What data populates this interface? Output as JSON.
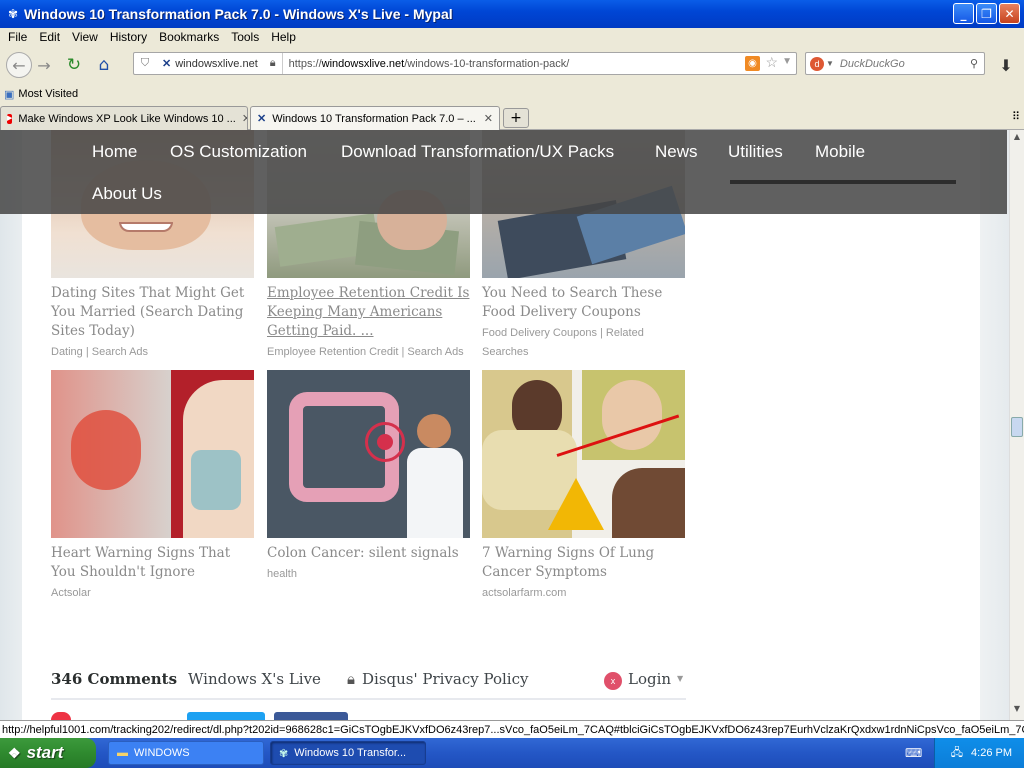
{
  "window": {
    "title": "Windows 10 Transformation Pack 7.0 - Windows X's Live - Mypal"
  },
  "menu": [
    "File",
    "Edit",
    "View",
    "History",
    "Bookmarks",
    "Tools",
    "Help"
  ],
  "address": {
    "site": "windowsxlive.net",
    "url_prefix": "https://",
    "url_host": "windowsxlive.net",
    "url_path": "/windows-10-transformation-pack/"
  },
  "search": {
    "placeholder": "DuckDuckGo"
  },
  "bookmarks": {
    "most_visited": "Most Visited"
  },
  "tabs": [
    {
      "label": "Make Windows XP Look Like Windows 10 ..."
    },
    {
      "label": "Windows 10 Transformation Pack 7.0 – ..."
    }
  ],
  "site_nav": [
    "Home",
    "OS Customization",
    "Download Transformation/UX Packs",
    "News",
    "Utilities",
    "Mobile",
    "About Us"
  ],
  "cards": [
    {
      "title": "Dating Sites That Might Get You Married (Search Dating Sites Today)",
      "source": "Dating | Search Ads"
    },
    {
      "title": "Employee Retention Credit Is Keeping Many Americans Getting Paid. ...",
      "source": "Employee Retention Credit | Search Ads"
    },
    {
      "title": "You Need to Search These Food Delivery Coupons",
      "source": "Food Delivery Coupons | Related Searches"
    },
    {
      "title": "Heart Warning Signs That You Shouldn't Ignore",
      "source": "Actsolar"
    },
    {
      "title": "Colon Cancer: silent signals",
      "source": "health"
    },
    {
      "title": "7 Warning Signs Of Lung Cancer Symptoms",
      "source": "actsolarfarm.com"
    }
  ],
  "comments": {
    "count": "346 Comments",
    "site": "Windows X's Live",
    "privacy": "Disqus' Privacy Policy",
    "login": "Login"
  },
  "status": {
    "text": "http://helpful1001.com/tracking202/redirect/dl.php?t202id=968628c1=GiCsTOgbEJKVxfDO6z43rep7...sVco_faO5eiLm_7CAQ#tblciGiCsTOgbEJKVxfDO6z43rep7EurhVclzaKrQxdxw1rdnNiCpsVco_faO5eiLm_7CAQ"
  },
  "taskbar": {
    "start": "start",
    "items": [
      "WINDOWS",
      "Windows 10 Transfor..."
    ],
    "clock": "4:26 PM"
  }
}
